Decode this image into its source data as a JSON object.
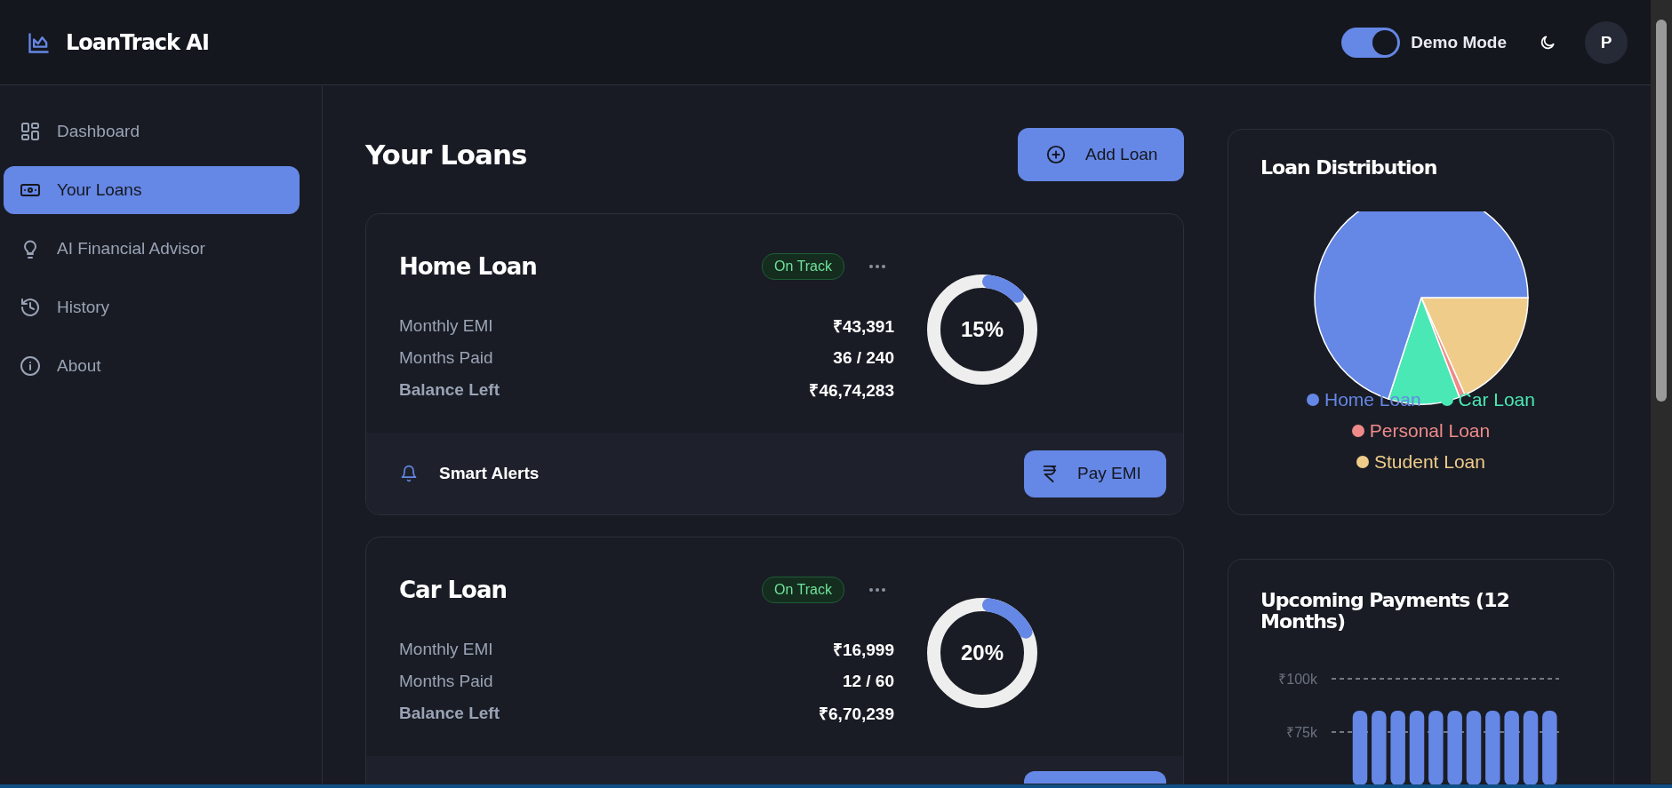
{
  "app": {
    "title": "LoanTrack AI"
  },
  "header": {
    "demo_mode": {
      "label": "Demo Mode",
      "on": true
    },
    "avatar": "P"
  },
  "sidebar": {
    "items": [
      {
        "label": "Dashboard",
        "selected": false
      },
      {
        "label": "Your Loans",
        "selected": true
      },
      {
        "label": "AI Financial Advisor",
        "selected": false
      },
      {
        "label": "History",
        "selected": false
      },
      {
        "label": "About",
        "selected": false
      }
    ]
  },
  "main": {
    "title": "Your Loans",
    "add_button": "Add Loan",
    "loans": [
      {
        "name": "Home Loan",
        "status": "On Track",
        "level": 0.15,
        "progress": "15%",
        "rows": [
          {
            "label": "Monthly EMI",
            "value": "₹43,391",
            "kind": "normal"
          },
          {
            "label": "Months Paid",
            "value": "36 / 240",
            "kind": "normal"
          },
          {
            "label": "Balance Left",
            "value": "₹46,74,283",
            "kind": "total"
          }
        ],
        "footer": {
          "alerts": "Smart Alerts",
          "pay_button": "Pay EMI"
        }
      },
      {
        "name": "Car Loan",
        "status": "On Track",
        "level": 0.2,
        "progress": "20%",
        "rows": [
          {
            "label": "Monthly EMI",
            "value": "₹16,999",
            "kind": "normal"
          },
          {
            "label": "Months Paid",
            "value": "12 / 60",
            "kind": "normal"
          },
          {
            "label": "Balance Left",
            "value": "₹6,70,239",
            "kind": "total"
          }
        ],
        "footer_cut": true
      }
    ]
  },
  "distribution": {
    "title": "Loan Distribution",
    "legend": [
      {
        "label": "Home Loan",
        "color": "#6587e5"
      },
      {
        "label": "Car Loan",
        "color": "#4ae8b4"
      },
      {
        "label": "Personal Loan",
        "color": "#ef8a8a"
      },
      {
        "label": "Student Loan",
        "color": "#efcc8a"
      }
    ]
  },
  "upcoming": {
    "title": "Upcoming Payments (12 Months)",
    "chart_data": {
      "type": "bar",
      "values": [
        null,
        85000,
        85000,
        85000,
        85000,
        85000,
        85000,
        85000,
        85000,
        85000,
        85000,
        85000
      ],
      "ylim": [
        50000,
        100000
      ],
      "yticks": [
        {
          "value": 75000,
          "label": "₹75k"
        },
        {
          "value": 100000,
          "label": "₹100k"
        }
      ]
    }
  }
}
